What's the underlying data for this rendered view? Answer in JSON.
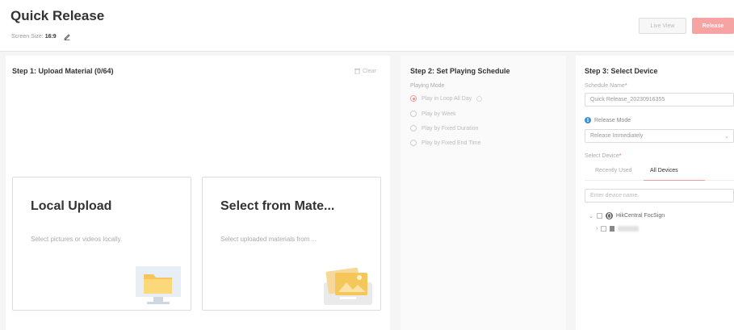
{
  "header": {
    "title": "Quick Release",
    "screen_size_label": "Screen Size:",
    "screen_size_value": "16:9",
    "live_view_label": "Live View",
    "release_label": "Release"
  },
  "step1": {
    "title": "Step 1: Upload Material (0/64)",
    "clear_label": "Clear",
    "cards": [
      {
        "title": "Local Upload",
        "desc": "Select pictures or videos locally."
      },
      {
        "title": "Select from Mate...",
        "desc": "Select uploaded materials from ..."
      }
    ]
  },
  "step2": {
    "title": "Step 2: Set Playing Schedule",
    "playing_mode_label": "Playing Mode",
    "options": [
      "Play in Loop All Day",
      "Play by Week",
      "Play by Fixed Duration",
      "Play by Fixed End Time"
    ]
  },
  "step3": {
    "title": "Step 3: Select Device",
    "schedule_name_label": "Schedule Name",
    "schedule_name_value": "Quick Release_20230916355",
    "release_mode_label": "Release Mode",
    "release_mode_value": "Release Immediately",
    "select_device_label": "Select Device",
    "tab_recent": "Recently Used",
    "tab_all": "All Devices",
    "search_placeholder": "Enter device name.",
    "tree_root": "HikCentral FocSign"
  },
  "colors": {
    "accent": "#f29b9b",
    "release_button": "#f5a3a3",
    "info_blue": "#3d8fd8"
  }
}
